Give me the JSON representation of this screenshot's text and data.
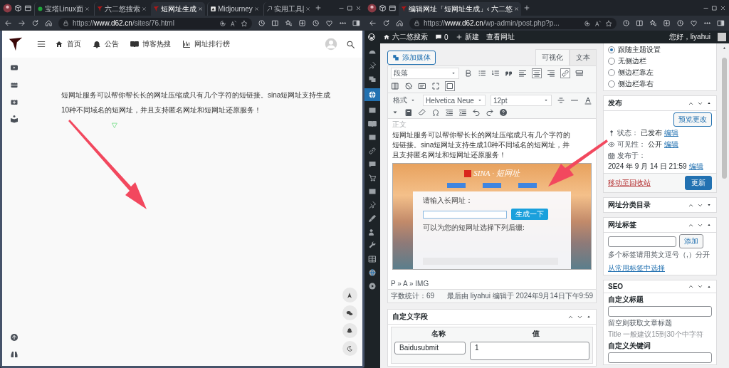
{
  "left_window": {
    "tabs": [
      {
        "title": "宝塔Linux面",
        "selected": false
      },
      {
        "title": "六二悠搜索",
        "selected": false
      },
      {
        "title": "短网址生成",
        "selected": true
      },
      {
        "title": "Midjourney",
        "selected": false
      },
      {
        "title": "实用工具|",
        "selected": false
      }
    ],
    "address": "https://**www.d62.cn**/sites/76.html",
    "site": {
      "nav": [
        "首页",
        "公告",
        "博客热搜",
        "网址排行榜"
      ],
      "description": "短网址服务可以帮你帮长长的网址压缩成只有几个字符的短链接。sina短网址支持生成10种不同域名的短网址，并且支持匿名网址和短网址还原服务！"
    }
  },
  "right_window": {
    "tabs": [
      {
        "title": "编辑网址「短网址生成」‹ 六二悠",
        "selected": true
      }
    ],
    "address": "https://**www.d62.cn**/wp-admin/post.php?p...",
    "admin_bar": {
      "site": "六二悠搜索",
      "comments": "0",
      "new": "新建",
      "view": "查看网址",
      "greeting": "您好，liyahui"
    },
    "editor": {
      "add_media": "添加媒体",
      "modes": [
        {
          "label": "可视化",
          "selected": true
        },
        {
          "label": "文本",
          "selected": false
        }
      ],
      "block_format": "段落",
      "format_menu": "格式",
      "font_family": "Helvetica Neue",
      "font_size": "12pt",
      "area_label": "正文",
      "paragraph": "短网址服务可以帮你帮长长的网址压缩成只有几个字符的短链接。sina短网址支持生成10种不同域名的短网址，并且支持匿名网址和短网址还原服务！",
      "embedded_screenshot": {
        "title": "SINA · 短网址",
        "input_label": "请输入长网址：",
        "button": "生成一下",
        "suffix_label": "可以为您的短网址选择下列后缀:"
      },
      "path": "P » A » IMG",
      "word_count": "字数统计：69",
      "last_edited": "最后由 liyahui 编辑于 2024年9月14日下午9:59"
    },
    "custom_fields": {
      "title": "自定义字段",
      "columns": [
        "名称",
        "值"
      ],
      "rows": [
        {
          "name": "Baidusubmit",
          "value": "1"
        }
      ]
    },
    "sidebar": {
      "layout_options": [
        {
          "label": "跟随主题设置",
          "selected": true
        },
        {
          "label": "无侧边栏",
          "selected": false
        },
        {
          "label": "侧边栏靠左",
          "selected": false
        },
        {
          "label": "侧边栏靠右",
          "selected": false
        }
      ],
      "publish": {
        "title": "发布",
        "expanded": true,
        "preview": "预览更改",
        "rows": [
          {
            "label": "状态：",
            "value": "已发布",
            "link": "编辑"
          },
          {
            "label": "可见性：",
            "value": "公开",
            "link": "编辑"
          },
          {
            "label": "发布于：",
            "value": "2024 年 9 月 14 日 21:59",
            "link": "编辑"
          }
        ],
        "trash": "移动至回收站",
        "update": "更新"
      },
      "category_box": {
        "title": "网址分类目录",
        "expanded": false
      },
      "tags_box": {
        "title": "网址标签",
        "expanded": true,
        "add": "添加",
        "hint": "多个标签请用英文逗号（,）分开",
        "choose": "从常用标签中选择"
      },
      "seo": {
        "title": "SEO",
        "expanded": true,
        "fields": [
          {
            "label": "自定义标题",
            "hint": "留空则获取文章标题",
            "note": "Title 一般建议15到30个中字符"
          },
          {
            "label": "自定义关键词"
          }
        ]
      }
    }
  }
}
